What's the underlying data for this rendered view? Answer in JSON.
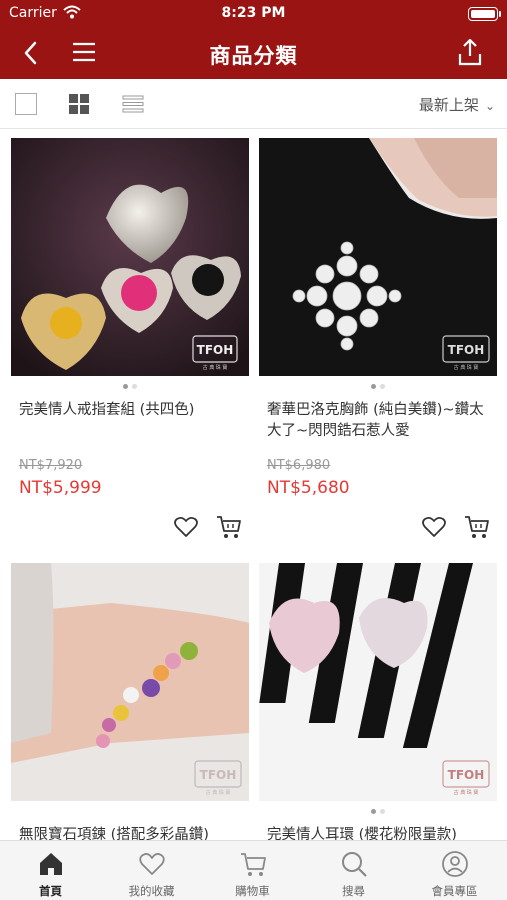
{
  "status": {
    "carrier": "Carrier",
    "time": "8:23 PM"
  },
  "header": {
    "title": "商品分類"
  },
  "toolbar": {
    "sort_label": "最新上架"
  },
  "products": [
    {
      "name": "完美情人戒指套組 (共四色)",
      "old_price": "NT$7,920",
      "price": "NT$5,999",
      "image_mark": "TFOH",
      "image_mark_sub": "古 典 珠 寶"
    },
    {
      "name": "奢華巴洛克胸飾 (純白美鑽)~鑽太大了~閃閃鋯石惹人愛",
      "old_price": "NT$6,980",
      "price": "NT$5,680",
      "image_mark": "TFOH",
      "image_mark_sub": "古 典 珠 寶"
    },
    {
      "name": "無限寶石項鍊 (搭配多彩晶鑽)",
      "image_mark": "TFOH",
      "image_mark_sub": "古 典 珠 寶"
    },
    {
      "name": "完美情人耳環 (櫻花粉限量款)",
      "image_mark": "TFOH",
      "image_mark_sub": "古 典 珠 寶"
    }
  ],
  "tabbar": [
    {
      "label": "首頁",
      "icon": "home-icon"
    },
    {
      "label": "我的收藏",
      "icon": "heart-icon"
    },
    {
      "label": "購物車",
      "icon": "cart-icon"
    },
    {
      "label": "搜尋",
      "icon": "search-icon"
    },
    {
      "label": "會員專區",
      "icon": "user-icon"
    }
  ],
  "colors": {
    "brand": "#9b1414",
    "price": "#e53935",
    "muted": "#999999"
  }
}
